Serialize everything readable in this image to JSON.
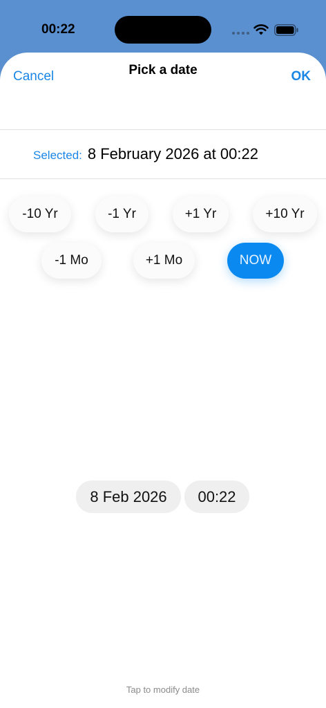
{
  "status_bar": {
    "time": "00:22"
  },
  "nav": {
    "cancel_label": "Cancel",
    "title": "Pick a date",
    "ok_label": "OK"
  },
  "selected": {
    "label": "Selected:",
    "value": "8 February 2026 at 00:22"
  },
  "adjust_buttons": {
    "minus_10_yr": "-10 Yr",
    "minus_1_yr": "-1 Yr",
    "plus_1_yr": "+1 Yr",
    "plus_10_yr": "+10 Yr",
    "minus_1_mo": "-1 Mo",
    "plus_1_mo": "+1 Mo",
    "now": "NOW"
  },
  "picker": {
    "date": "8 Feb 2026",
    "time": "00:22"
  },
  "hint": "Tap to modify date",
  "colors": {
    "accent": "#1a86e6",
    "now_button": "#0a8af0",
    "header_background": "#5a8fd0"
  }
}
